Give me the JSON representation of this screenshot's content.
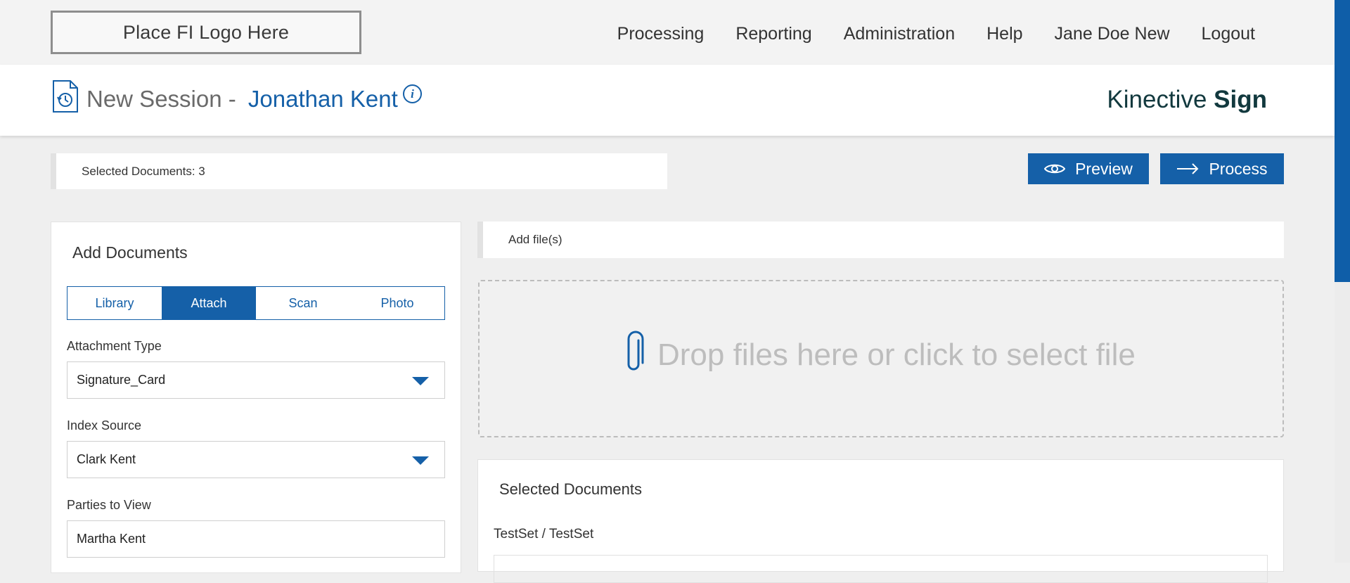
{
  "topbar": {
    "logo_text": "Place FI Logo Here",
    "nav": [
      "Processing",
      "Reporting",
      "Administration",
      "Help",
      "Jane Doe New",
      "Logout"
    ]
  },
  "header": {
    "title_prefix": "New Session -",
    "customer_name": "Jonathan Kent",
    "info_glyph": "i",
    "brand_light": "Kinective",
    "brand_bold": "Sign"
  },
  "summary": {
    "selected_documents": "Selected Documents: 3"
  },
  "actions": {
    "preview_label": "Preview",
    "process_label": "Process"
  },
  "add_documents": {
    "title": "Add Documents",
    "tabs": [
      {
        "label": "Library",
        "active": false
      },
      {
        "label": "Attach",
        "active": true
      },
      {
        "label": "Scan",
        "active": false
      },
      {
        "label": "Photo",
        "active": false
      }
    ],
    "attachment_type": {
      "label": "Attachment Type",
      "value": "Signature_Card"
    },
    "index_source": {
      "label": "Index Source",
      "value": "Clark Kent"
    },
    "parties_to_view": {
      "label": "Parties to View",
      "value": "Martha Kent"
    }
  },
  "upload": {
    "add_files_label": "Add file(s)",
    "drop_text": "Drop files here or click to select file"
  },
  "selected_documents": {
    "title": "Selected Documents",
    "set_name": "TestSet / TestSet"
  },
  "colors": {
    "accent": "#1560a8",
    "brand": "#12393e",
    "background": "#efefef"
  },
  "icons": [
    "history-document-icon",
    "info-icon",
    "eye-icon",
    "arrow-right-icon",
    "paperclip-icon",
    "chevron-down-icon"
  ]
}
